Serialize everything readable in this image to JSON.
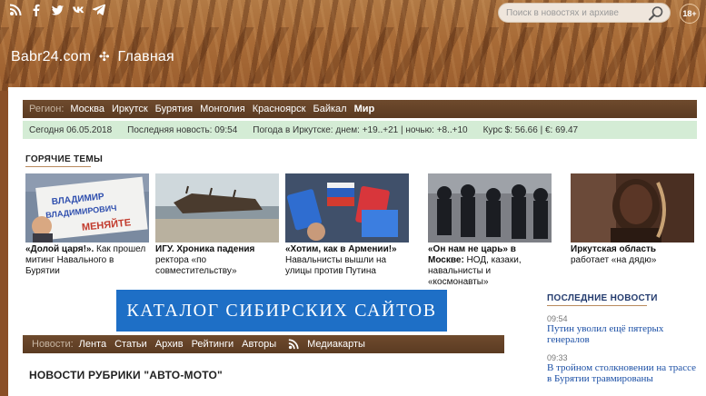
{
  "header": {
    "search_placeholder": "Поиск в новостях и архиве",
    "age_badge": "18+",
    "site_name": "Babr24.com",
    "separator": "✣",
    "page_name": "Главная",
    "social_icons": [
      "rss-icon",
      "facebook-icon",
      "twitter-icon",
      "vk-icon",
      "telegram-icon"
    ]
  },
  "region_bar": {
    "label": "Регион:",
    "items": [
      "Москва",
      "Иркутск",
      "Бурятия",
      "Монголия",
      "Красноярск",
      "Байкал",
      "Мир"
    ],
    "active": "Мир"
  },
  "info_bar": {
    "today": "Сегодня 06.05.2018",
    "last_news": "Последняя новость: 09:54",
    "weather": "Погода в Иркутске: днем: +19..+21 | ночью: +8..+10",
    "rates": "Курс $: 56.66 | €: 69.47"
  },
  "hot_topics": {
    "title": "ГОРЯЧИЕ ТЕМЫ",
    "cards": [
      {
        "bold": "«Долой царя!».",
        "rest": " Как прошел митинг Навального в Бурятии",
        "image_text": "ВЛАДИМИР ВЛАДИМИРОВИЧ МЕНЯЙТЕ"
      },
      {
        "bold": "ИГУ. Хроника падения",
        "rest": " ректора «по совместительству»",
        "image_text": ""
      },
      {
        "bold": "«Хотим, как в Армении!»",
        "rest": " Навальнисты вышли на улицы против Путина",
        "image_text": ""
      },
      {
        "bold": "«Он нам не царь» в Москве:",
        "rest": " НОД, казаки, навальнисты и «космонавты»",
        "image_text": ""
      },
      {
        "bold": "Иркутская область",
        "rest": " работает «на дядю»",
        "image_text": ""
      }
    ]
  },
  "catalog_banner": "КАТАЛОГ СИБИРСКИХ САЙТОВ",
  "news_bar": {
    "label": "Новости:",
    "items": [
      "Лента",
      "Статьи",
      "Архив",
      "Рейтинги",
      "Авторы"
    ],
    "mediacards": "Медиакарты"
  },
  "rubric_title": "НОВОСТИ РУБРИКИ \"АВТО-МОТО\"",
  "latest_news": {
    "title": "ПОСЛЕДНИЕ НОВОСТИ",
    "items": [
      {
        "time": "09:54",
        "headline": "Путин уволил ещё пятерых генералов"
      },
      {
        "time": "09:33",
        "headline": "В тройном столкновении на трассе в Бурятии травмированы"
      }
    ]
  },
  "colors": {
    "brown_bar": "#6e4a2d",
    "info_green": "#d4ecd5",
    "catalog_blue": "#1e6fc6",
    "news_link": "#1b4fa5"
  }
}
